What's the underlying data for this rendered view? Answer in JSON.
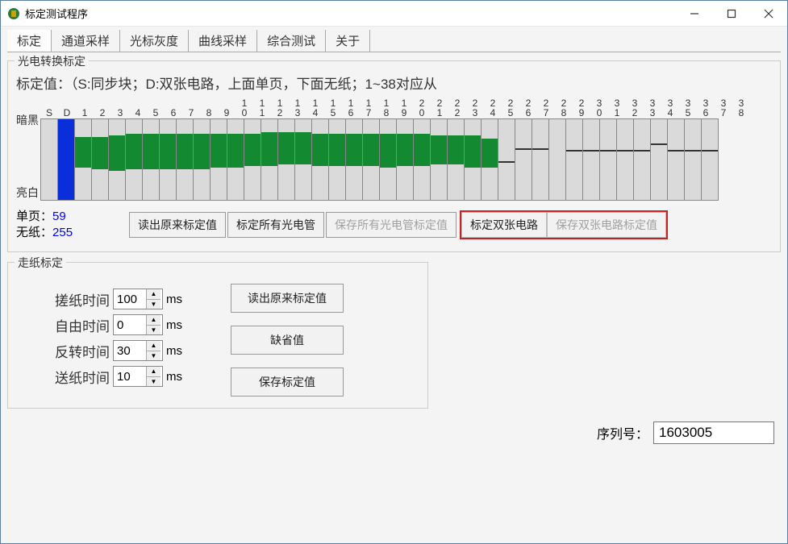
{
  "window": {
    "title": "标定测试程序"
  },
  "tabs": [
    "标定",
    "通道采样",
    "光标灰度",
    "曲线采样",
    "综合测试",
    "关于"
  ],
  "active_tab": 0,
  "calib_group": {
    "legend": "光电转换标定",
    "value_text": "标定值：（S:同步块；D:双张电路，上面单页，下面无纸；1~38对应从",
    "y_top": "暗黑",
    "y_bottom": "亮白",
    "headers": [
      "S",
      "D",
      "1",
      "2",
      "3",
      "4",
      "5",
      "6",
      "7",
      "8",
      "9",
      "10",
      "11",
      "12",
      "13",
      "14",
      "15",
      "16",
      "17",
      "18",
      "19",
      "20",
      "21",
      "22",
      "23",
      "24",
      "25",
      "26",
      "27",
      "28",
      "29",
      "30",
      "31",
      "32",
      "33",
      "34",
      "35",
      "36",
      "37",
      "38"
    ],
    "bars": [
      {
        "type": "gray"
      },
      {
        "type": "blue",
        "top": 0,
        "h": 100
      },
      {
        "type": "green",
        "top": 22,
        "h": 38
      },
      {
        "type": "green",
        "top": 22,
        "h": 40
      },
      {
        "type": "green",
        "top": 20,
        "h": 44
      },
      {
        "type": "green",
        "top": 18,
        "h": 44
      },
      {
        "type": "green",
        "top": 18,
        "h": 44
      },
      {
        "type": "green",
        "top": 18,
        "h": 44
      },
      {
        "type": "green",
        "top": 18,
        "h": 44
      },
      {
        "type": "green",
        "top": 18,
        "h": 44
      },
      {
        "type": "green",
        "top": 18,
        "h": 42
      },
      {
        "type": "green",
        "top": 18,
        "h": 42
      },
      {
        "type": "green",
        "top": 18,
        "h": 40
      },
      {
        "type": "green",
        "top": 16,
        "h": 42
      },
      {
        "type": "green",
        "top": 16,
        "h": 40
      },
      {
        "type": "green",
        "top": 16,
        "h": 40
      },
      {
        "type": "green",
        "top": 18,
        "h": 40
      },
      {
        "type": "green",
        "top": 18,
        "h": 40
      },
      {
        "type": "green",
        "top": 18,
        "h": 40
      },
      {
        "type": "green",
        "top": 18,
        "h": 40
      },
      {
        "type": "green",
        "top": 18,
        "h": 42
      },
      {
        "type": "green",
        "top": 18,
        "h": 40
      },
      {
        "type": "green",
        "top": 18,
        "h": 40
      },
      {
        "type": "green",
        "top": 20,
        "h": 36
      },
      {
        "type": "green",
        "top": 20,
        "h": 36
      },
      {
        "type": "green",
        "top": 20,
        "h": 40
      },
      {
        "type": "green",
        "top": 24,
        "h": 36
      },
      {
        "type": "tick",
        "pos": 52
      },
      {
        "type": "tick",
        "pos": 36
      },
      {
        "type": "tick",
        "pos": 36
      },
      {
        "type": "gray"
      },
      {
        "type": "tick",
        "pos": 38
      },
      {
        "type": "tick",
        "pos": 38
      },
      {
        "type": "tick",
        "pos": 38
      },
      {
        "type": "tick",
        "pos": 38
      },
      {
        "type": "tick",
        "pos": 38
      },
      {
        "type": "tick",
        "pos": 30
      },
      {
        "type": "tick",
        "pos": 38
      },
      {
        "type": "tick",
        "pos": 38
      },
      {
        "type": "tick",
        "pos": 38
      }
    ],
    "info": {
      "l1_label": "单页：",
      "l1_value": "59",
      "l2_label": "无纸：",
      "l2_value": "255"
    },
    "buttons": {
      "read_orig": "读出原来标定值",
      "calib_all": "标定所有光电管",
      "save_all": "保存所有光电管标定值",
      "calib_dual": "标定双张电路",
      "save_dual": "保存双张电路标定值"
    }
  },
  "paper_group": {
    "legend": "走纸标定",
    "rows": [
      {
        "label": "搓纸时间",
        "value": "100",
        "unit": "ms"
      },
      {
        "label": "自由时间",
        "value": "0",
        "unit": "ms"
      },
      {
        "label": "反转时间",
        "value": "30",
        "unit": "ms"
      },
      {
        "label": "送纸时间",
        "value": "10",
        "unit": "ms"
      }
    ],
    "buttons": {
      "read": "读出原来标定值",
      "default": "缺省值",
      "save": "保存标定值"
    }
  },
  "serial": {
    "label": "序列号：",
    "value": "1603005"
  },
  "chart_data": {
    "type": "bar",
    "title": "光电转换标定",
    "categories": [
      "S",
      "D",
      "1",
      "2",
      "3",
      "4",
      "5",
      "6",
      "7",
      "8",
      "9",
      "10",
      "11",
      "12",
      "13",
      "14",
      "15",
      "16",
      "17",
      "18",
      "19",
      "20",
      "21",
      "22",
      "23",
      "24",
      "25",
      "26",
      "27",
      "28",
      "29",
      "30",
      "31",
      "32",
      "33",
      "34",
      "35",
      "36",
      "37",
      "38"
    ],
    "series": [
      {
        "name": "暗黑",
        "values": [
          null,
          0,
          56,
          56,
          51,
          46,
          46,
          46,
          46,
          46,
          46,
          46,
          46,
          41,
          41,
          41,
          46,
          46,
          46,
          46,
          46,
          46,
          46,
          51,
          51,
          51,
          61,
          133,
          92,
          92,
          null,
          97,
          97,
          97,
          97,
          97,
          77,
          97,
          97,
          97
        ]
      },
      {
        "name": "亮白",
        "values": [
          null,
          255,
          153,
          158,
          163,
          158,
          158,
          158,
          158,
          158,
          153,
          153,
          148,
          148,
          143,
          143,
          148,
          148,
          148,
          148,
          153,
          148,
          148,
          143,
          143,
          153,
          153,
          133,
          92,
          92,
          null,
          97,
          97,
          97,
          97,
          97,
          77,
          97,
          97,
          97
        ]
      }
    ],
    "ylim": [
      0,
      255
    ],
    "ylabel_top": "暗黑",
    "ylabel_bottom": "亮白",
    "note": "Values approximate; D column uses full-height blue; ticks for channels 25+ represent single-value markers"
  }
}
